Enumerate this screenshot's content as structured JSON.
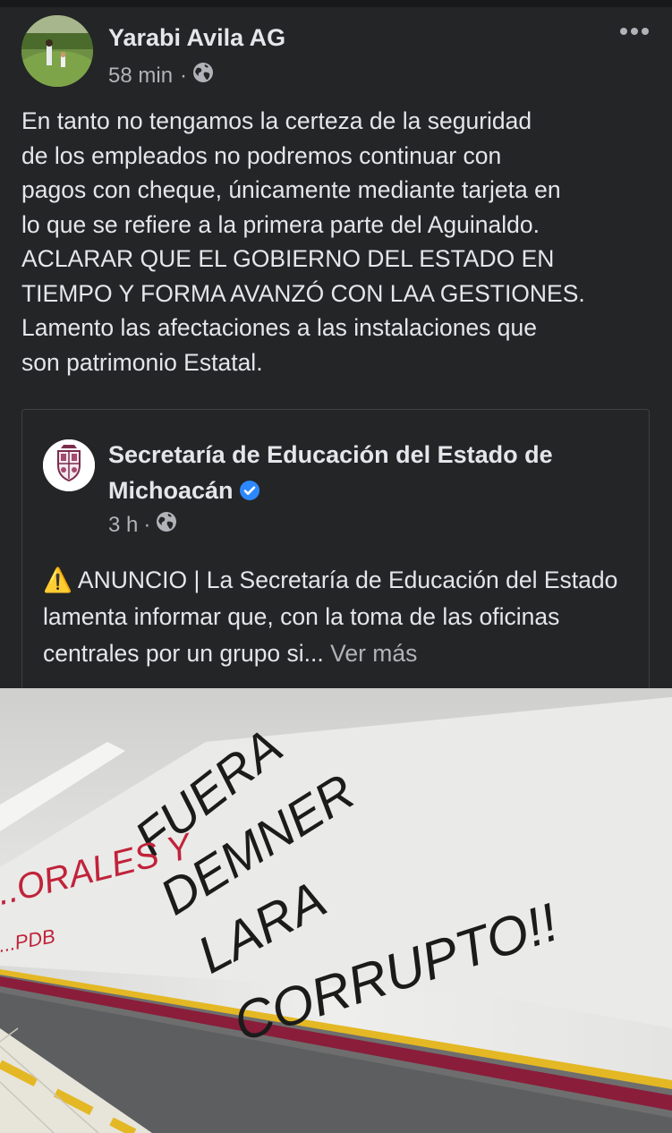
{
  "post": {
    "author": "Yarabi Avila AG",
    "time": "58 min",
    "separator": "·",
    "audience_icon": "globe-icon",
    "more_icon": "more-horizontal-icon",
    "text": "En tanto no tengamos la certeza de la seguridad\nde los empleados no podremos continuar con\npagos con cheque, únicamente mediante tarjeta en\nlo que se refiere a la primera parte del Aguinaldo.\nACLARAR QUE EL GOBIERNO DEL ESTADO EN\nTIEMPO Y FORMA AVANZÓ CON LAA GESTIONES.\nLamento las afectaciones a las instalaciones que\nson patrimonio Estatal."
  },
  "shared": {
    "page_name": "Secretaría de Educación del Estado de Michoacán",
    "verified_icon": "verified-badge-icon",
    "time": "3 h",
    "separator": "·",
    "audience_icon": "globe-icon",
    "warning_icon": "⚠️",
    "text": "ANUNCIO | La Secretaría de Educación del Estado lamenta informar que, con la toma de las oficinas centrales por un grupo si...",
    "see_more": "Ver más"
  },
  "photo": {
    "graffiti_black": [
      "FUERA",
      "DEMNER",
      "LARA",
      "CORRUPTO!!"
    ],
    "graffiti_red": [
      "...ORALES Y",
      "...PDB"
    ]
  },
  "colors": {
    "background": "#242526",
    "text": "#e4e6eb",
    "secondary_text": "#b0b3b8",
    "verified": "#2d88ff",
    "stripe_red": "#8a1d3a",
    "stripe_yellow": "#e4b824"
  }
}
